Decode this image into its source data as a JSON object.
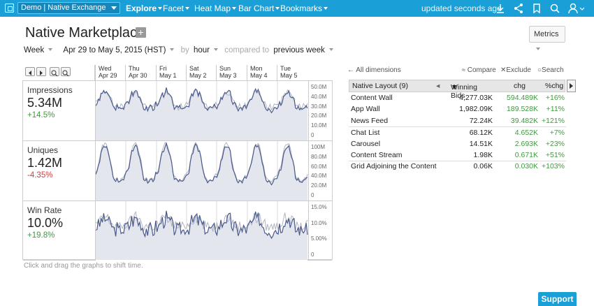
{
  "topbar": {
    "datasource": "Demo | Native Exchange",
    "nav": [
      "Explore",
      "Facet",
      "Heat Map",
      "Bar Chart",
      "Bookmarks"
    ],
    "updated": "updated seconds ago"
  },
  "title": "Native Marketplace",
  "metrics_button": "Metrics",
  "filters": {
    "granularity": "Week",
    "range": "Apr 29 to May 5, 2015 (HST)",
    "by": "by",
    "bucket": "hour",
    "compared_to": "compared to",
    "comparison": "previous week"
  },
  "dates": [
    {
      "day": "Wed",
      "date": "Apr 29"
    },
    {
      "day": "Thu",
      "date": "Apr 30"
    },
    {
      "day": "Fri",
      "date": "May 1"
    },
    {
      "day": "Sat",
      "date": "May 2"
    },
    {
      "day": "Sun",
      "date": "May 3"
    },
    {
      "day": "Mon",
      "date": "May 4"
    },
    {
      "day": "Tue",
      "date": "May 5"
    }
  ],
  "metrics": [
    {
      "name": "Impressions",
      "value": "5.34M",
      "change": "+14.5%",
      "trend": "pos",
      "ticks": [
        "50.0M",
        "40.0M",
        "30.0M",
        "20.0M",
        "10.0M",
        "0"
      ]
    },
    {
      "name": "Uniques",
      "value": "1.42M",
      "change": "-4.35%",
      "trend": "neg",
      "ticks": [
        "100M",
        "80.0M",
        "60.0M",
        "40.0M",
        "20.0M",
        "0"
      ]
    },
    {
      "name": "Win Rate",
      "value": "10.0%",
      "change": "+19.8%",
      "trend": "pos",
      "ticks": [
        "15.0%",
        "10.0%",
        "5.00%",
        "0"
      ]
    }
  ],
  "hint": "Click and drag the graphs to shift time.",
  "dims_header": {
    "all": "All dimensions",
    "compare": "Compare",
    "exclude": "Exclude",
    "search": "Search"
  },
  "table": {
    "dimension": "Native Layout (9)",
    "col_measure": "Winning Bids",
    "col_chg": "chg",
    "col_pchg": "%chg",
    "rows": [
      {
        "name": "Content Wall",
        "bids": "4,277.03K",
        "chg": "594.489K",
        "pchg": "+16%"
      },
      {
        "name": "App Wall",
        "bids": "1,982.09K",
        "chg": "189.528K",
        "pchg": "+11%"
      },
      {
        "name": "News Feed",
        "bids": "72.24K",
        "chg": "39.482K",
        "pchg": "+121%"
      },
      {
        "name": "Chat List",
        "bids": "68.12K",
        "chg": "4.652K",
        "pchg": "+7%"
      },
      {
        "name": "Carousel",
        "bids": "14.51K",
        "chg": "2.693K",
        "pchg": "+23%"
      },
      {
        "name": "Content Stream",
        "bids": "1.98K",
        "chg": "0.671K",
        "pchg": "+51%"
      },
      {
        "name": "Grid Adjoining the Content",
        "bids": "0.06K",
        "chg": "0.030K",
        "pchg": "+103%"
      }
    ]
  },
  "support": "Support",
  "colors": {
    "brand": "#1a9fd6",
    "positive": "#3e9a3e",
    "negative": "#d23b3b",
    "series_current": "#4a5a8c",
    "series_previous": "#b0b4c0"
  }
}
